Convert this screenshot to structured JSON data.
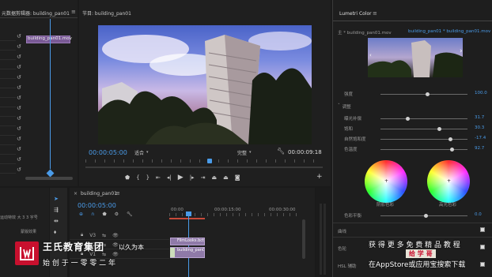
{
  "source_panel": {
    "tab": "元数据剪辑器: building_pan01",
    "clip_label": "building_pan01.mov"
  },
  "program_monitor": {
    "tab": "节目: building_pan01",
    "timecode_left": "00:00:05:00",
    "fit_value": "适合",
    "quality_value": "完整",
    "timecode_right": "00:00:09:18"
  },
  "lumetri": {
    "tab": "Lumetri Color",
    "header_left": "主 * building_pan01.mov",
    "header_right": "building_pan01 * building_pan01.mov",
    "strength_label": "强度",
    "strength_value": "100.0",
    "section_label": "调整",
    "rows": [
      {
        "label": "曝光补偿",
        "value": "31.7"
      },
      {
        "label": "饱和",
        "value": "30.3"
      },
      {
        "label": "自然饱和度",
        "value": "-17.4"
      },
      {
        "label": "色温度",
        "value": "92.7"
      }
    ],
    "wheel1_label": "阴影色彩",
    "wheel2_label": "高光色彩",
    "balance_label": "色彩平衡",
    "balance_value": "0.0",
    "curves_label": "曲线",
    "wheels_label": "色轮",
    "hsl_label": "HSL 辅助"
  },
  "timeline": {
    "tab": "building_pan01",
    "timecode": "00:00:05:00",
    "ruler": [
      "00:00",
      "00:00:15:00",
      "00:00:30:00"
    ],
    "clip1": "FilmLooks.bct",
    "clip2": "building_pan01",
    "left_text1": "运动特效 大 3 3 字号",
    "left_text2": "蒙版效果"
  },
  "watermark": {
    "brand": "王氏教育集团",
    "slogan": "始 创 于 一 零 零 二 年",
    "ad_line1": "获 得 更 多 免 费 精 品 教 程",
    "ad_badge": "给 学 哥",
    "ad_line2": "在AppStore或应用宝搜索下载",
    "suffix": "以久为本"
  },
  "colors": {
    "accent": "#4a9be8",
    "brand_red": "#c8102e"
  }
}
